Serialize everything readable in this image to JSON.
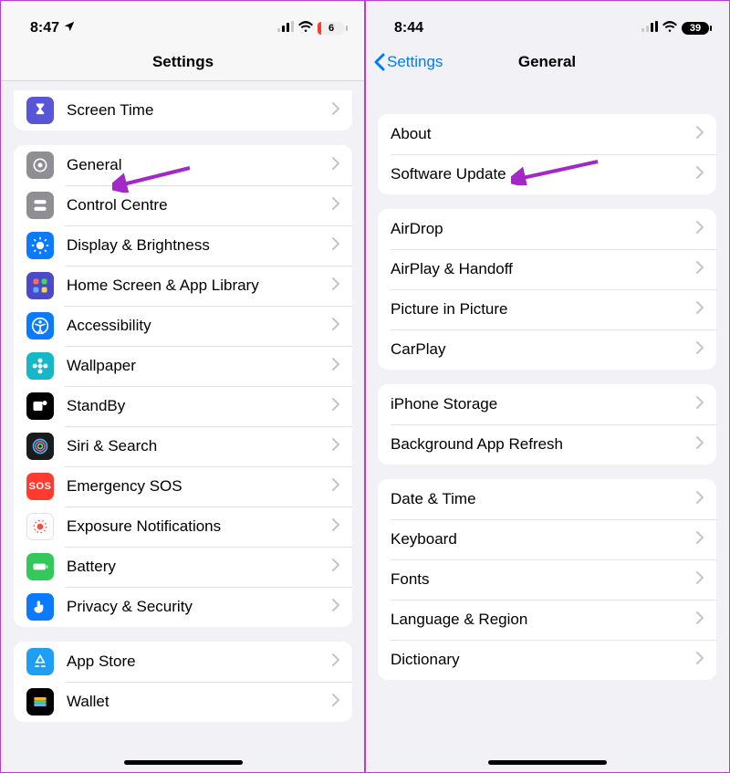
{
  "left": {
    "status": {
      "time": "8:47",
      "battery": "6"
    },
    "title": "Settings",
    "group0": [
      {
        "label": "Screen Time",
        "iconName": "hourglass-icon",
        "iconBg": "#5856d6"
      }
    ],
    "group1": [
      {
        "label": "General",
        "iconName": "gear-icon",
        "iconBg": "#8e8e93"
      },
      {
        "label": "Control Centre",
        "iconName": "toggles-icon",
        "iconBg": "#8e8e93"
      },
      {
        "label": "Display & Brightness",
        "iconName": "sun-icon",
        "iconBg": "#0a7aff"
      },
      {
        "label": "Home Screen & App Library",
        "iconName": "apps-grid-icon",
        "iconBg": "#4b4ac9"
      },
      {
        "label": "Accessibility",
        "iconName": "accessibility-icon",
        "iconBg": "#0a7aff"
      },
      {
        "label": "Wallpaper",
        "iconName": "flower-icon",
        "iconBg": "#16b8c8"
      },
      {
        "label": "StandBy",
        "iconName": "standby-icon",
        "iconBg": "#000000"
      },
      {
        "label": "Siri & Search",
        "iconName": "siri-icon",
        "iconBg": "#1b1b1d"
      },
      {
        "label": "Emergency SOS",
        "iconName": "sos-icon",
        "iconBg": "#ff3b30"
      },
      {
        "label": "Exposure Notifications",
        "iconName": "exposure-icon",
        "iconBg": "#ffffff"
      },
      {
        "label": "Battery",
        "iconName": "battery-icon",
        "iconBg": "#34c759"
      },
      {
        "label": "Privacy & Security",
        "iconName": "hand-icon",
        "iconBg": "#0a7aff"
      }
    ],
    "group2": [
      {
        "label": "App Store",
        "iconName": "appstore-icon",
        "iconBg": "#1e9ef4"
      },
      {
        "label": "Wallet",
        "iconName": "wallet-icon",
        "iconBg": "#000000"
      }
    ]
  },
  "right": {
    "status": {
      "time": "8:44",
      "battery": "39"
    },
    "back": "Settings",
    "title": "General",
    "group0": [
      {
        "label": "About"
      },
      {
        "label": "Software Update"
      }
    ],
    "group1": [
      {
        "label": "AirDrop"
      },
      {
        "label": "AirPlay & Handoff"
      },
      {
        "label": "Picture in Picture"
      },
      {
        "label": "CarPlay"
      }
    ],
    "group2": [
      {
        "label": "iPhone Storage"
      },
      {
        "label": "Background App Refresh"
      }
    ],
    "group3": [
      {
        "label": "Date & Time"
      },
      {
        "label": "Keyboard"
      },
      {
        "label": "Fonts"
      },
      {
        "label": "Language & Region"
      },
      {
        "label": "Dictionary"
      }
    ]
  }
}
